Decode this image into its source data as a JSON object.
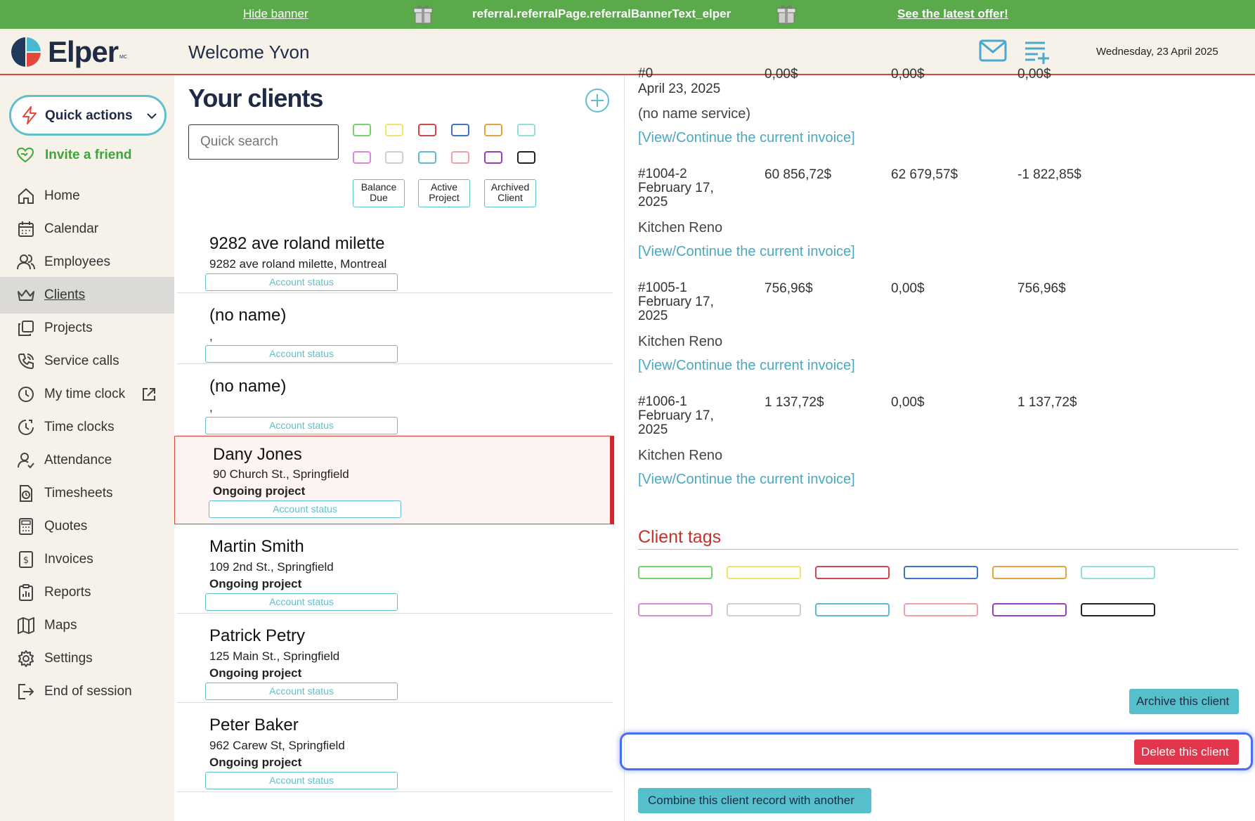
{
  "banner": {
    "hide_label": "Hide banner",
    "text": "referral.referralPage.referralBannerText_elper",
    "offer_label": "See the latest offer!"
  },
  "header": {
    "logo_text": "Elper",
    "logo_mark": "MC",
    "welcome": "Welcome Yvon",
    "date": "Wednesday, 23 April 2025"
  },
  "sidebar": {
    "quick_actions": "Quick actions",
    "invite": "Invite a friend",
    "items": [
      {
        "label": "Home",
        "icon": "home-icon"
      },
      {
        "label": "Calendar",
        "icon": "calendar-icon"
      },
      {
        "label": "Employees",
        "icon": "employees-icon"
      },
      {
        "label": "Clients",
        "icon": "crown-icon",
        "active": true
      },
      {
        "label": "Projects",
        "icon": "projects-icon"
      },
      {
        "label": "Service calls",
        "icon": "phone-icon"
      },
      {
        "label": "My time clock",
        "icon": "clock-icon"
      },
      {
        "label": "Time clocks",
        "icon": "time-clocks-icon"
      },
      {
        "label": "Attendance",
        "icon": "attendance-icon"
      },
      {
        "label": "Timesheets",
        "icon": "timesheet-icon"
      },
      {
        "label": "Quotes",
        "icon": "calculator-icon"
      },
      {
        "label": "Invoices",
        "icon": "invoice-icon"
      },
      {
        "label": "Reports",
        "icon": "reports-icon"
      },
      {
        "label": "Maps",
        "icon": "map-icon"
      },
      {
        "label": "Settings",
        "icon": "gear-icon"
      },
      {
        "label": "End of session",
        "icon": "logout-icon"
      }
    ]
  },
  "clients": {
    "title": "Your clients",
    "search_placeholder": "Quick search",
    "filters": {
      "balance_due": [
        "Balance",
        "Due"
      ],
      "active_project": [
        "Active",
        "Project"
      ],
      "archived_client": [
        "Archived",
        "Client"
      ]
    },
    "account_status_label": "Account status",
    "list": [
      {
        "name": "9282 ave roland milette",
        "address": "9282 ave roland milette, Montreal",
        "status": ""
      },
      {
        "name": "(no name)",
        "address": ",",
        "status": ""
      },
      {
        "name": "(no name)",
        "address": ",",
        "status": ""
      },
      {
        "name": "Dany Jones",
        "address": "90 Church St., Springfield",
        "status": "Ongoing project",
        "selected": true
      },
      {
        "name": "Martin Smith",
        "address": "109 2nd St., Springfield",
        "status": "Ongoing project"
      },
      {
        "name": "Patrick Petry",
        "address": "125 Main St., Springfield",
        "status": "Ongoing project"
      },
      {
        "name": "Peter Baker",
        "address": "962 Carew St, Springfield",
        "status": "Ongoing project"
      }
    ]
  },
  "tag_colors": [
    "#6fd46a",
    "#f0e46a",
    "#d9434a",
    "#3d72c6",
    "#e8a23c",
    "#8fe0d8",
    "#d88ad6",
    "#cfcfcf",
    "#5fb8d8",
    "#f0a0a8",
    "#9a3cc4",
    "#222222"
  ],
  "detail": {
    "partial_invoice": {
      "num": "#0",
      "date": "April 23, 2025",
      "a1": "0,00$",
      "a2": "0,00$",
      "a3": "0,00$",
      "service": "(no name service)",
      "link": "[View/Continue the current invoice]"
    },
    "invoices": [
      {
        "num": "#1004-2",
        "date1": "February 17,",
        "date2": "2025",
        "a1": "60 856,72$",
        "a2": "62 679,57$",
        "a3": "-1 822,85$",
        "service": "Kitchen Reno",
        "link": "[View/Continue the current invoice]"
      },
      {
        "num": "#1005-1",
        "date1": "February 17,",
        "date2": "2025",
        "a1": "756,96$",
        "a2": "0,00$",
        "a3": "756,96$",
        "service": "Kitchen Reno",
        "link": "[View/Continue the current invoice]"
      },
      {
        "num": "#1006-1",
        "date1": "February 17,",
        "date2": "2025",
        "a1": "1 137,72$",
        "a2": "0,00$",
        "a3": "1 137,72$",
        "service": "Kitchen Reno",
        "link": "[View/Continue the current invoice]"
      }
    ],
    "tags_title": "Client tags",
    "archive_label": "Archive this client",
    "delete_label": "Delete this client",
    "combine_label": "Combine this client record with another"
  }
}
